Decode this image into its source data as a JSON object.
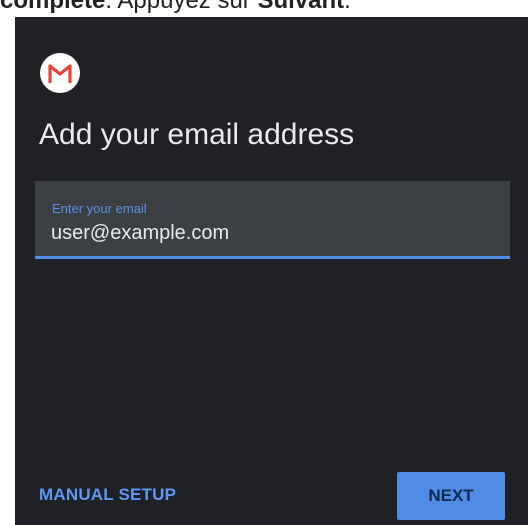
{
  "caption": {
    "part1": "complete",
    "part2": ". Appuyez sur ",
    "part3": "Suivant",
    "part4": "."
  },
  "logo": {
    "icon": "gmail-icon"
  },
  "title": "Add your email address",
  "email_field": {
    "label": "Enter your email",
    "value": "user@example.com"
  },
  "actions": {
    "manual_setup": "MANUAL SETUP",
    "next": "NEXT"
  },
  "colors": {
    "background": "#202124",
    "field_background": "#3c4043",
    "accent": "#4f8ce6",
    "text": "#e8eaed"
  }
}
